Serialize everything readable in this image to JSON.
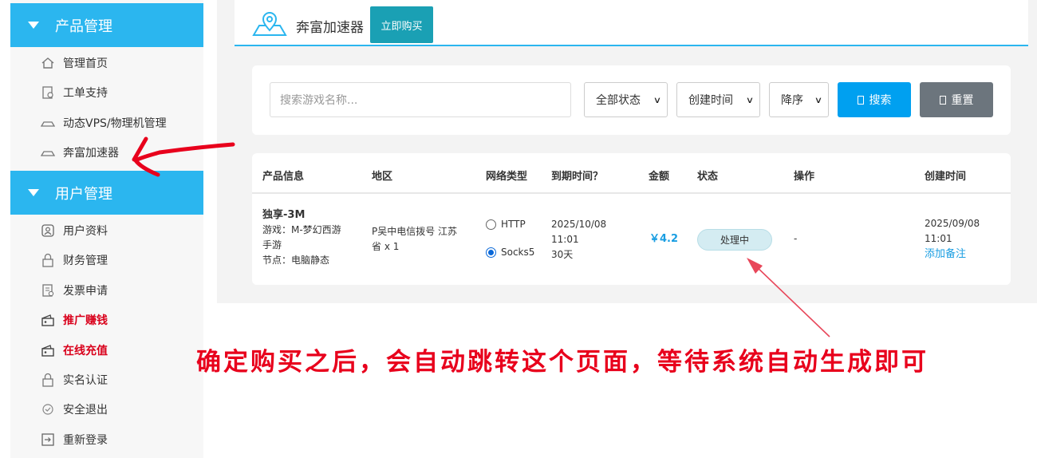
{
  "sidebar": {
    "sections": [
      {
        "title": "产品管理",
        "items": [
          {
            "label": "管理首页",
            "icon": "home-icon"
          },
          {
            "label": "工单支持",
            "icon": "ticket-icon"
          },
          {
            "label": "动态VPS/物理机管理",
            "icon": "server-icon"
          },
          {
            "label": "奔富加速器",
            "icon": "server-icon"
          }
        ]
      },
      {
        "title": "用户管理",
        "items": [
          {
            "label": "用户资料",
            "icon": "user-icon"
          },
          {
            "label": "财务管理",
            "icon": "lock-icon"
          },
          {
            "label": "发票申请",
            "icon": "invoice-icon"
          },
          {
            "label": "推广赚钱",
            "icon": "wallet-icon"
          },
          {
            "label": "在线充值",
            "icon": "wallet-icon"
          },
          {
            "label": "实名认证",
            "icon": "lock-icon"
          },
          {
            "label": "安全退出",
            "icon": "check-circle-icon"
          },
          {
            "label": "重新登录",
            "icon": "login-icon"
          }
        ]
      }
    ],
    "highlight_color": "#d9001b",
    "header_color": "#2bb6ef"
  },
  "header": {
    "title": "奔富加速器",
    "buy_label": "立即购买",
    "icon": "map-pin-icon"
  },
  "search": {
    "placeholder": "搜索游戏名称...",
    "status_select": "全部状态",
    "sort_field_select": "创建时间",
    "order_select": "降序",
    "search_label": "搜索",
    "reset_label": "重置"
  },
  "table": {
    "headers": [
      "产品信息",
      "地区",
      "网络类型",
      "到期时间？",
      "金额",
      "状态",
      "操作",
      "创建时间"
    ],
    "rows": [
      {
        "product_name": "独享-3M",
        "game_line1": "游戏：M-梦幻西游",
        "game_line2": "手游",
        "node": "节点：电脑静态",
        "region_line1": "P吴中电信拨号 江苏",
        "region_line2": "省 x 1",
        "net_http": "HTTP",
        "net_socks": "Socks5",
        "net_selected": "Socks5",
        "expire_date": "2025/10/08",
        "expire_time": "11:01",
        "expire_days": "30天",
        "amount": "￥4.2",
        "status": "处理中",
        "action": "-",
        "created_date": "2025/09/08",
        "created_time": "11:01",
        "add_note": "添加备注"
      }
    ]
  },
  "annotation": {
    "text": "确定购买之后，会自动跳转这个页面，等待系统自动生成即可",
    "color": "#e8001c"
  }
}
